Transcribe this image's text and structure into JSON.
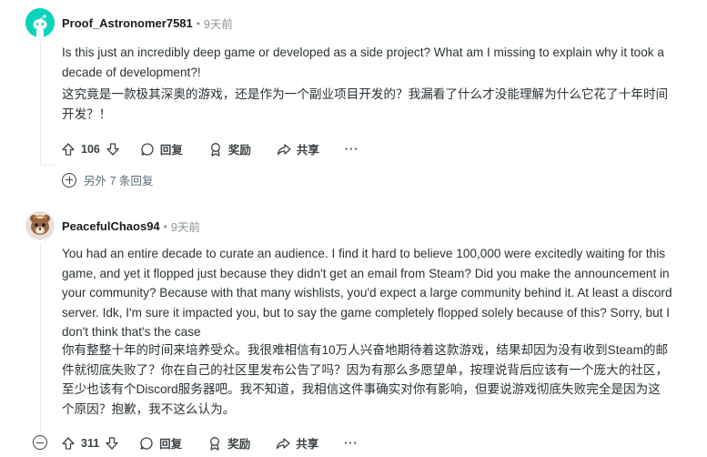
{
  "comments": [
    {
      "author": "Proof_Astronomer7581",
      "separator": "•",
      "time": "9天前",
      "text_en": "Is this just an incredibly deep game or developed as a side project? What am I missing to explain why it took a decade of development?!",
      "text_zh": "这究竟是一款极其深奥的游戏，还是作为一个副业项目开发的？我漏看了什么才没能理解为什么它花了十年时间开发？！",
      "votes": "106",
      "reply_label": "回复",
      "award_label": "奖励",
      "share_label": "共享",
      "more_label": "···",
      "more_replies": "另外 7 条回复"
    },
    {
      "author": "PeacefulChaos94",
      "separator": "•",
      "time": "9天前",
      "text_en": "You had an entire decade to curate an audience. I find it hard to believe 100,000 were excitedly waiting for this game, and yet it flopped just because they didn't get an email from Steam? Did you make the announcement in your community? Because with that many wishlists, you'd expect a large community behind it. At least a discord server. Idk, I'm sure it impacted you, but to say the game completely flopped solely because of this? Sorry, but I don't think that's the case",
      "text_zh": "你有整整十年的时间来培养受众。我很难相信有10万人兴奋地期待着这款游戏，结果却因为没有收到Steam的邮件就彻底失败了？你在自己的社区里发布公告了吗？因为有那么多愿望单，按理说背后应该有一个庞大的社区，至少也该有个Discord服务器吧。我不知道，我相信这件事确实对你有影响，但要说游戏彻底失败完全是因为这个原因？抱歉，我不这么认为。",
      "votes": "311",
      "reply_label": "回复",
      "award_label": "奖励",
      "share_label": "共享",
      "more_label": "···"
    }
  ],
  "colors": {
    "avatar1_bg": "#0dd3bb",
    "text": "#2a3236",
    "meta": "#8a9296",
    "icon": "#3c4346"
  }
}
